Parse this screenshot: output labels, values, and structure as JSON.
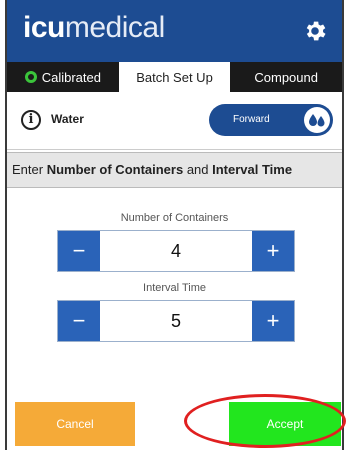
{
  "header": {
    "logo_bold": "icu",
    "logo_light": "medical",
    "settings_icon": "gear-icon",
    "bg_color": "#1d4c92"
  },
  "tabs": [
    {
      "label": "Calibrated",
      "icon": "status-dot-icon",
      "active": false
    },
    {
      "label": "Batch Set Up",
      "active": true
    },
    {
      "label": "Compound",
      "active": false
    }
  ],
  "info_row": {
    "info_icon": "info-icon",
    "fluid_name": "Water",
    "direction_label": "Forward",
    "direction_icon": "droplets-icon"
  },
  "instruction": {
    "prefix": "Enter ",
    "bold1": "Number of Containers",
    "middle": " and ",
    "bold2": "Interval Time"
  },
  "containers": {
    "label": "Number of Containers",
    "value": "4",
    "minus": "−",
    "plus": "+"
  },
  "interval": {
    "label": "Interval Time",
    "value": "5",
    "minus": "−",
    "plus": "+"
  },
  "footer": {
    "cancel_label": "Cancel",
    "accept_label": "Accept",
    "cancel_color": "#f5aa38",
    "accept_color": "#22e61e",
    "highlight_color": "#e02020"
  }
}
